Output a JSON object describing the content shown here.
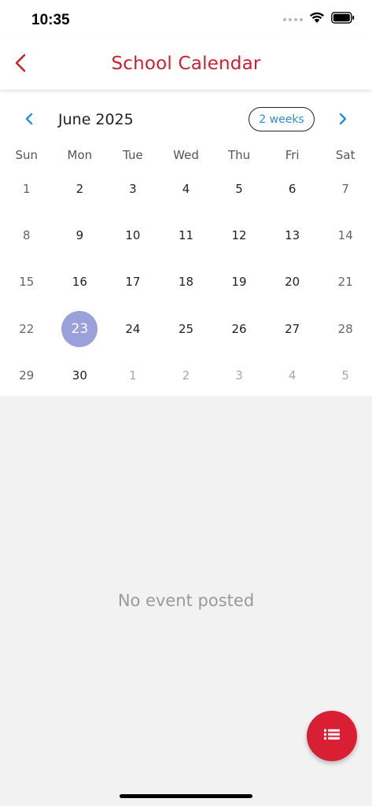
{
  "status_bar": {
    "time": "10:35"
  },
  "header": {
    "title": "School Calendar",
    "back_icon": "chevron-left-icon",
    "accent_color": "#d0202f"
  },
  "calendar": {
    "month_label": "June 2025",
    "format_button_label": "2 weeks",
    "prev_icon": "chevron-left-icon",
    "next_icon": "chevron-right-icon",
    "nav_color": "#2a8fd6",
    "weekdays": [
      "Sun",
      "Mon",
      "Tue",
      "Wed",
      "Thu",
      "Fri",
      "Sat"
    ],
    "selected_color": "#9aa1da",
    "weeks": [
      [
        "1",
        "2",
        "3",
        "4",
        "5",
        "6",
        "7"
      ],
      [
        "8",
        "9",
        "10",
        "11",
        "12",
        "13",
        "14"
      ],
      [
        "15",
        "16",
        "17",
        "18",
        "19",
        "20",
        "21"
      ],
      [
        "22",
        "23",
        "24",
        "25",
        "26",
        "27",
        "28"
      ],
      [
        "29",
        "30",
        "1",
        "2",
        "3",
        "4",
        "5"
      ]
    ]
  },
  "events": {
    "empty_message": "No event posted"
  },
  "fab": {
    "icon": "list-icon",
    "color": "#d81f33"
  }
}
